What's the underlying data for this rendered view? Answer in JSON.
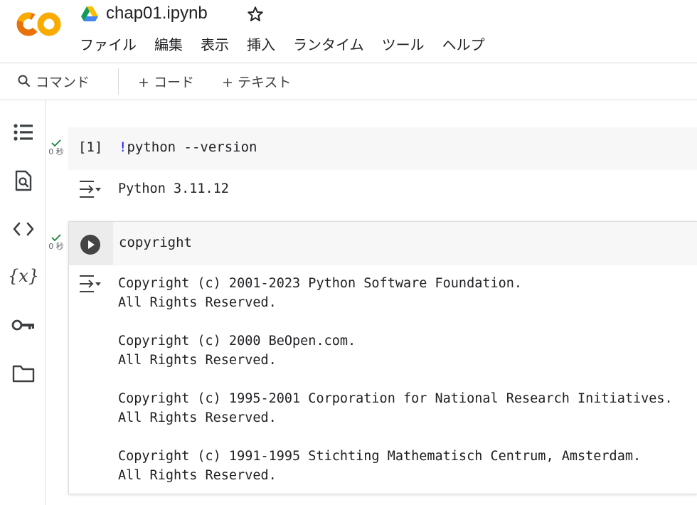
{
  "app": {
    "title": "chap01.ipynb",
    "colors": {
      "logo_orange": "#F9AB00",
      "logo_dark": "#E8710A",
      "check_green": "#188038"
    }
  },
  "menu": [
    "ファイル",
    "編集",
    "表示",
    "挿入",
    "ランタイム",
    "ツール",
    "ヘルプ"
  ],
  "toolbar": {
    "command_label": "コマンド",
    "add_code_label": "+ コード",
    "add_text_label": "+ テキスト"
  },
  "sidebar": {
    "icons": [
      "table-of-contents-icon",
      "find-icon",
      "code-snippets-icon",
      "variables-icon",
      "secrets-key-icon",
      "folder-icon"
    ],
    "variables_glyph": "{x}"
  },
  "cells": [
    {
      "exec_count": "[1]",
      "exec_time": "0 秒",
      "code_bang": "!",
      "code_rest": "python --version",
      "output": "Python 3.11.12"
    },
    {
      "exec_time": "0 秒",
      "code": "copyright",
      "output": "Copyright (c) 2001-2023 Python Software Foundation.\nAll Rights Reserved.\n\nCopyright (c) 2000 BeOpen.com.\nAll Rights Reserved.\n\nCopyright (c) 1995-2001 Corporation for National Research Initiatives.\nAll Rights Reserved.\n\nCopyright (c) 1991-1995 Stichting Mathematisch Centrum, Amsterdam.\nAll Rights Reserved."
    }
  ]
}
